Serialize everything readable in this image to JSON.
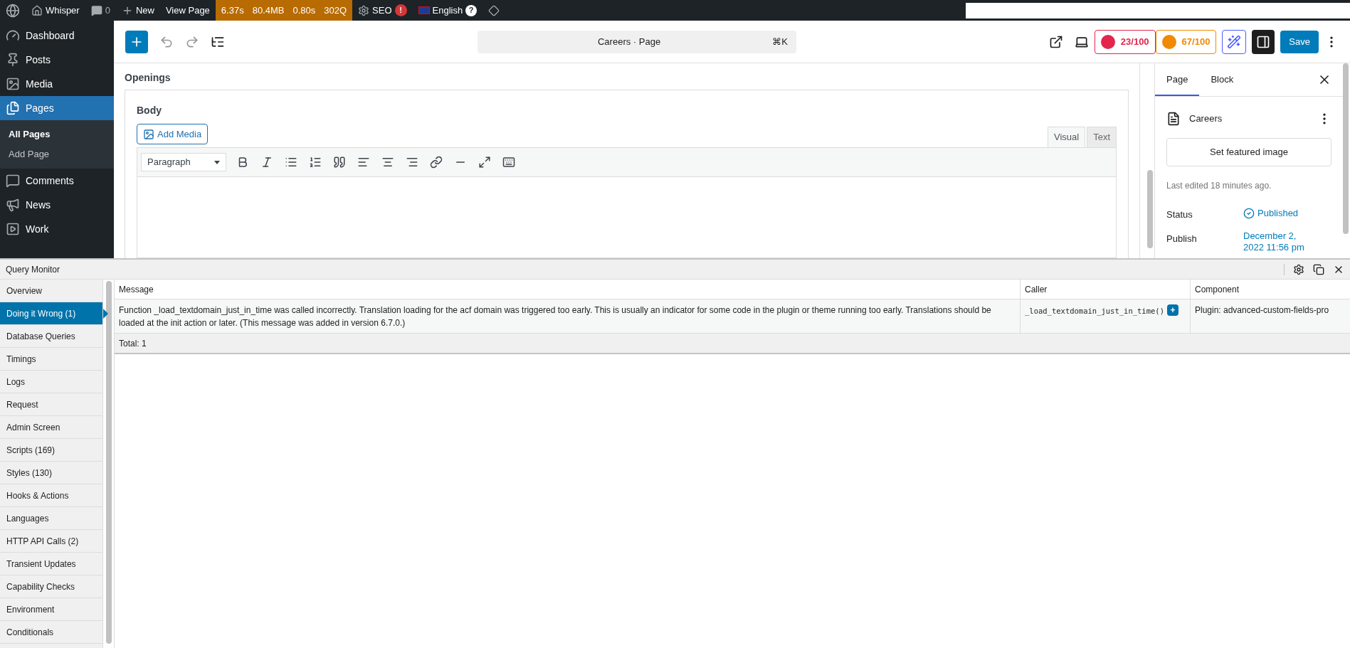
{
  "admin_bar": {
    "site": "Whisper",
    "comments": "0",
    "new": "New",
    "view": "View Page",
    "perf": [
      "6.37s",
      "80.4MB",
      "0.80s",
      "302Q"
    ],
    "seo": "SEO",
    "seo_badge": "!",
    "language": "English",
    "help": "?"
  },
  "admin_menu": [
    {
      "label": "Dashboard",
      "selected": false
    },
    {
      "label": "Posts",
      "selected": false
    },
    {
      "label": "Media",
      "selected": false
    },
    {
      "label": "Pages",
      "selected": true,
      "children": [
        {
          "label": "All Pages",
          "selected": true
        },
        {
          "label": "Add Page",
          "selected": false
        }
      ]
    },
    {
      "label": "Comments",
      "selected": false
    },
    {
      "label": "News",
      "selected": false
    },
    {
      "label": "Work",
      "selected": false
    }
  ],
  "editor_toolbar": {
    "command": "Careers · Page",
    "shortcut": "⌘K",
    "scores": [
      {
        "text": "23/100",
        "color": "#e2264d"
      },
      {
        "text": "67/100",
        "color": "#f08a00"
      }
    ],
    "save": "Save",
    "sidebar_open": true
  },
  "content": {
    "section": "Openings",
    "field": "Body",
    "add_media": "Add Media",
    "tabs": [
      {
        "label": "Visual",
        "selected": true
      },
      {
        "label": "Text",
        "selected": false
      }
    ],
    "format": "Paragraph"
  },
  "settings": {
    "tabs": [
      {
        "label": "Page",
        "selected": true
      },
      {
        "label": "Block",
        "selected": false
      }
    ],
    "title": "Careers",
    "featured": "Set featured image",
    "edited": "Last edited 18 minutes ago.",
    "rows": [
      {
        "label": "Status",
        "value": "Published",
        "kind": "status"
      },
      {
        "label": "Publish",
        "value": "December 2, 2022 11:56 pm",
        "kind": "link"
      }
    ]
  },
  "query_monitor": {
    "title": "Query Monitor",
    "nav": [
      {
        "label": "Overview",
        "selected": false
      },
      {
        "label": "Doing it Wrong (1)",
        "selected": true
      },
      {
        "label": "Database Queries",
        "selected": false
      },
      {
        "label": "Timings",
        "selected": false
      },
      {
        "label": "Logs",
        "selected": false
      },
      {
        "label": "Request",
        "selected": false
      },
      {
        "label": "Admin Screen",
        "selected": false
      },
      {
        "label": "Scripts (169)",
        "selected": false
      },
      {
        "label": "Styles (130)",
        "selected": false
      },
      {
        "label": "Hooks & Actions",
        "selected": false
      },
      {
        "label": "Languages",
        "selected": false
      },
      {
        "label": "HTTP API Calls (2)",
        "selected": false
      },
      {
        "label": "Transient Updates",
        "selected": false
      },
      {
        "label": "Capability Checks",
        "selected": false
      },
      {
        "label": "Environment",
        "selected": false
      },
      {
        "label": "Conditionals",
        "selected": false
      }
    ],
    "table": {
      "columns": [
        "Message",
        "Caller",
        "Component"
      ],
      "rows": [
        {
          "message": "Function _load_textdomain_just_in_time was called incorrectly. Translation loading for the acf domain was triggered too early. This is usually an indicator for some code in the plugin or theme running too early. Translations should be loaded at the init action or later. (This message was added in version 6.7.0.)",
          "caller": "_load_textdomain_just_in_time()",
          "expand": "+",
          "component": "Plugin: advanced-custom-fields-pro"
        }
      ],
      "total": "Total: 1"
    }
  }
}
